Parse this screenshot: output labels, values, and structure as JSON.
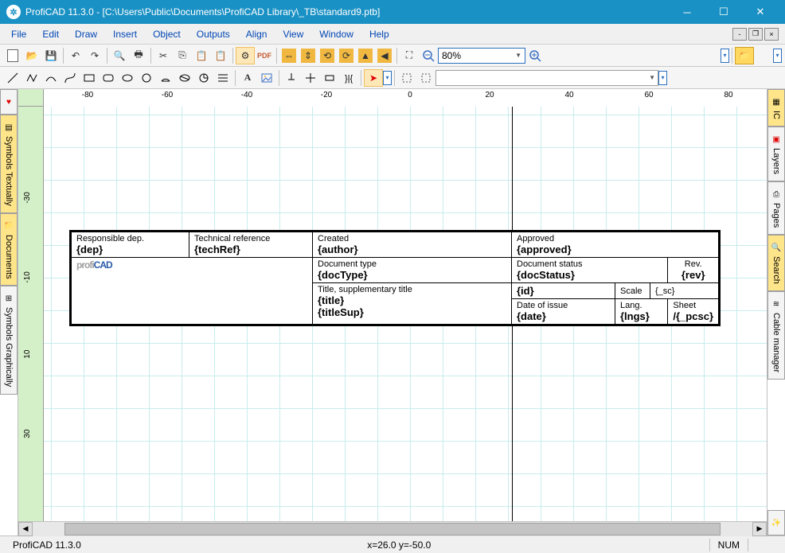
{
  "window": {
    "title": "ProfiCAD 11.3.0 - [C:\\Users\\Public\\Documents\\ProfiCAD Library\\_TB\\standard9.ptb]"
  },
  "menu": {
    "items": [
      "File",
      "Edit",
      "Draw",
      "Insert",
      "Object",
      "Outputs",
      "Align",
      "View",
      "Window",
      "Help"
    ]
  },
  "toolbar1": {
    "zoom": "80%",
    "pdf": "PDF"
  },
  "toolbar2": {
    "text_tool": "A"
  },
  "ruler": {
    "h_ticks": [
      "-80",
      "-60",
      "-40",
      "-20",
      "0",
      "20",
      "40",
      "60",
      "80"
    ],
    "v_ticks": [
      "-30",
      "-10",
      "10",
      "30"
    ]
  },
  "left_panel": {
    "tabs": [
      "Symbols Textually",
      "Documents",
      "Symbols Graphically"
    ]
  },
  "right_panel": {
    "tabs": [
      "IC",
      "Layers",
      "Pages",
      "Search",
      "Cable manager"
    ]
  },
  "titleblock": {
    "rows": {
      "resp_dep": {
        "label": "Responsible dep.",
        "value": "{dep}"
      },
      "tech_ref": {
        "label": "Technical reference",
        "value": "{techRef}"
      },
      "created": {
        "label": "Created",
        "value": "{author}"
      },
      "approved": {
        "label": "Approved",
        "value": "{approved}"
      },
      "doc_type": {
        "label": "Document type",
        "value": "{docType}"
      },
      "doc_status": {
        "label": "Document status",
        "value": "{docStatus}"
      },
      "rev": {
        "label": "Rev.",
        "value": "{rev}"
      },
      "title": {
        "label": "Title, supplementary title",
        "value": "{title}",
        "value2": "{titleSup}"
      },
      "id": {
        "value": "{id}"
      },
      "scale": {
        "label": "Scale",
        "value": "{_sc}"
      },
      "date": {
        "label": "Date of issue",
        "value": "{date}"
      },
      "lang": {
        "label": "Lang.",
        "value": "{lngs}"
      },
      "sheet": {
        "label": "Sheet",
        "value": "/{_pcsc}"
      }
    },
    "logo1": "profi",
    "logo2": "CAD"
  },
  "status": {
    "app": "ProfiCAD 11.3.0",
    "coords": "x=26.0  y=-50.0",
    "num": "NUM"
  }
}
